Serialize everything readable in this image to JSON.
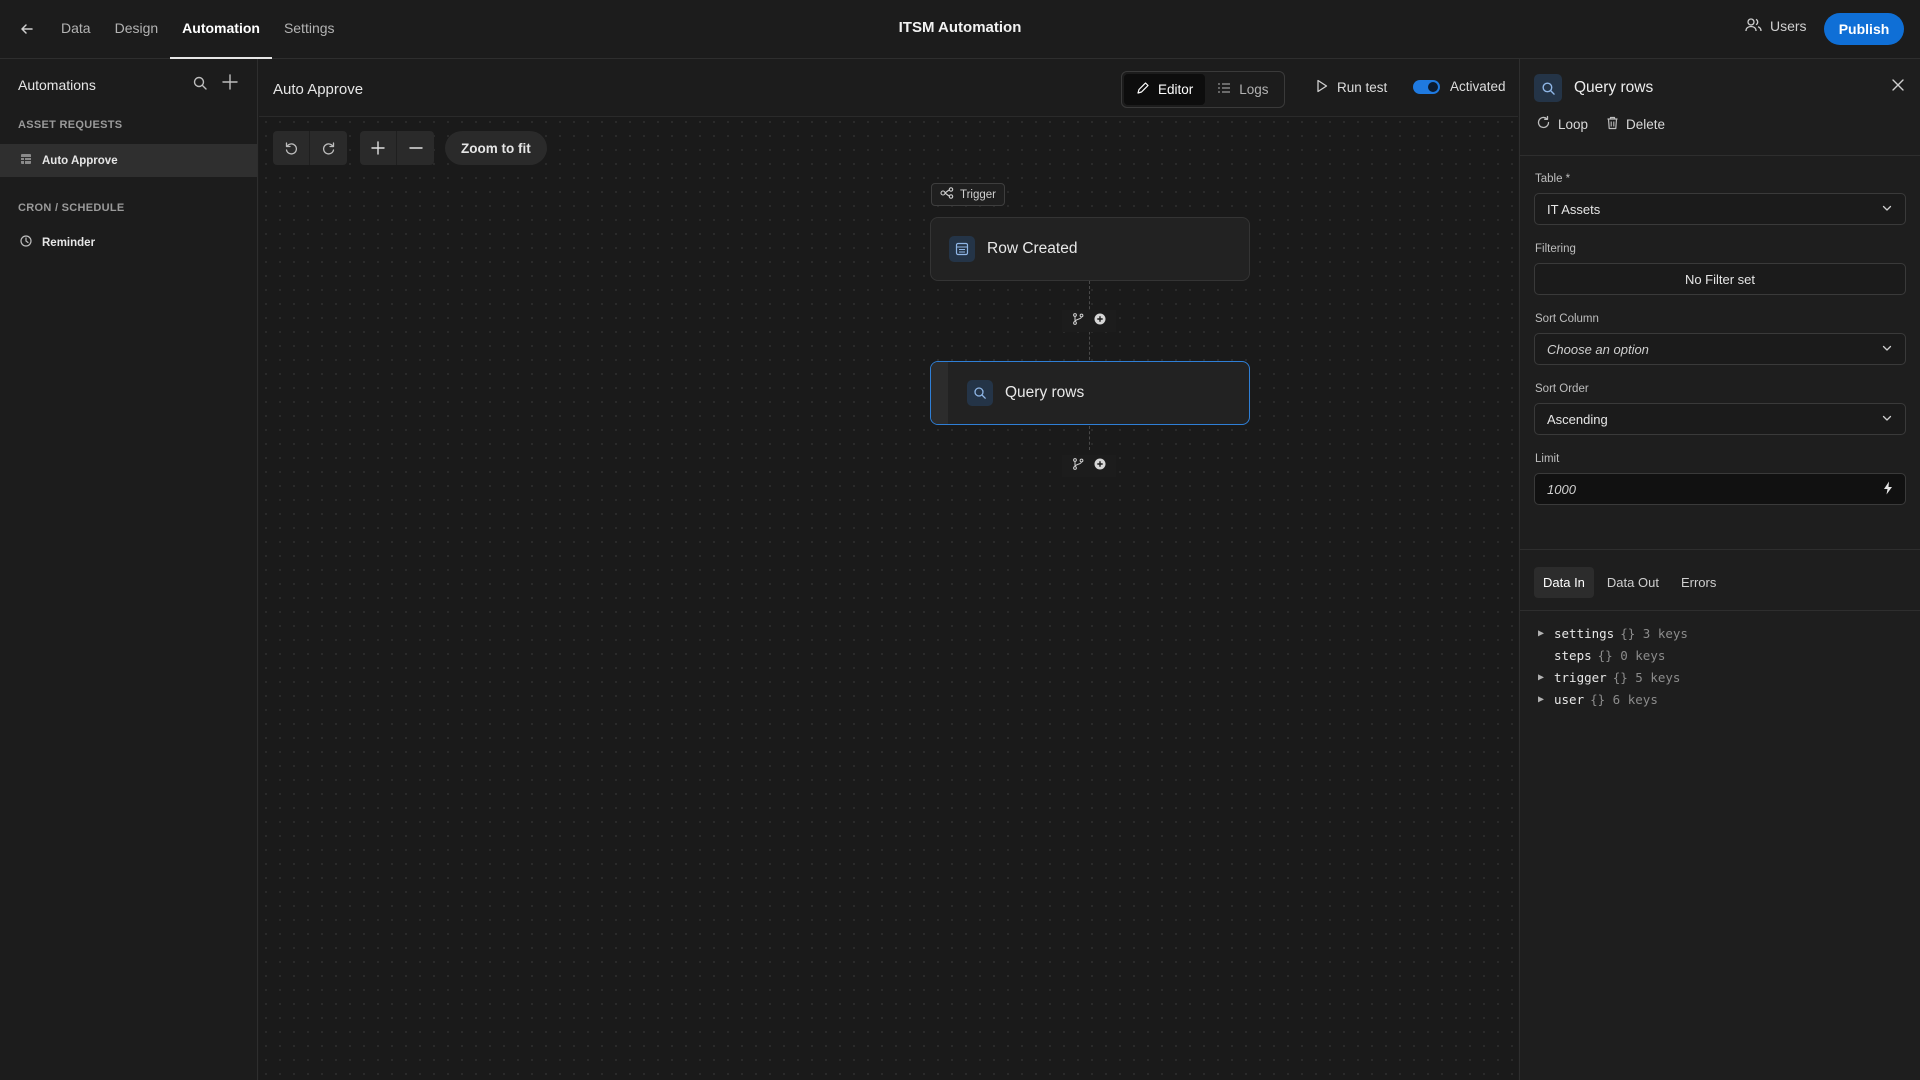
{
  "topbar": {
    "nav": [
      "Data",
      "Design",
      "Automation",
      "Settings"
    ],
    "active_nav": "Automation",
    "app_title": "ITSM Automation",
    "users_label": "Users",
    "publish_label": "Publish"
  },
  "sidebar": {
    "title": "Automations",
    "sections": [
      {
        "title": "ASSET REQUESTS",
        "items": [
          {
            "label": "Auto Approve",
            "icon": "table-icon",
            "active": true
          }
        ]
      },
      {
        "title": "CRON / SCHEDULE",
        "items": [
          {
            "label": "Reminder",
            "icon": "clock-icon",
            "active": false
          }
        ]
      }
    ]
  },
  "canvas": {
    "automation_name": "Auto Approve",
    "editor_label": "Editor",
    "logs_label": "Logs",
    "run_test_label": "Run test",
    "activated_label": "Activated",
    "activated": true,
    "zoom_fit_label": "Zoom to fit",
    "trigger_tag": "Trigger",
    "nodes": [
      {
        "label": "Row Created",
        "icon": "table-icon",
        "selected": false
      },
      {
        "label": "Query rows",
        "icon": "search-icon",
        "selected": true
      }
    ]
  },
  "panel": {
    "title": "Query rows",
    "loop_label": "Loop",
    "delete_label": "Delete",
    "table_label": "Table *",
    "table_value": "IT Assets",
    "filtering_label": "Filtering",
    "filtering_value": "No Filter set",
    "sort_column_label": "Sort Column",
    "sort_column_value": "Choose an option",
    "sort_order_label": "Sort Order",
    "sort_order_value": "Ascending",
    "limit_label": "Limit",
    "limit_value": "1000",
    "tabs": [
      "Data In",
      "Data Out",
      "Errors"
    ],
    "active_tab": "Data In",
    "data_in": [
      {
        "key": "settings",
        "meta": "{} 3 keys",
        "expandable": true
      },
      {
        "key": "steps",
        "meta": "{} 0 keys",
        "expandable": false
      },
      {
        "key": "trigger",
        "meta": "{} 5 keys",
        "expandable": true
      },
      {
        "key": "user",
        "meta": "{} 6 keys",
        "expandable": true
      }
    ]
  },
  "colors": {
    "accent": "#0f6fd6",
    "selected_border": "#2f7fd6",
    "background": "#1c1c1c"
  }
}
